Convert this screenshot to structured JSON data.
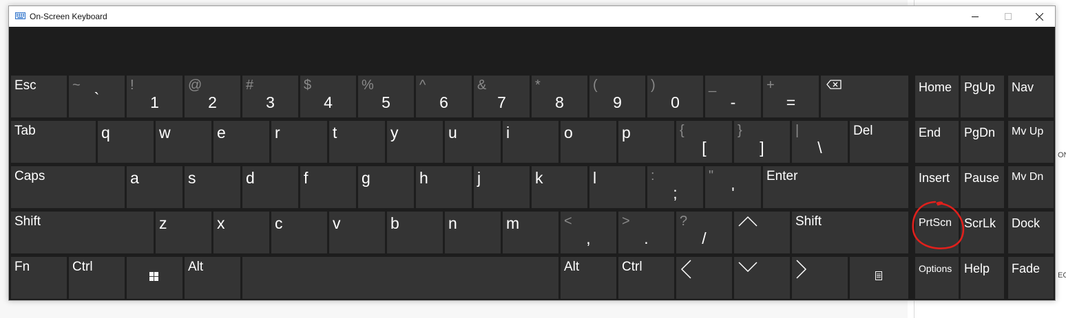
{
  "window": {
    "title": "On-Screen Keyboard"
  },
  "background": {
    "partial_text_1": "ON",
    "partial_text_2": "EC"
  },
  "keys": {
    "esc": "Esc",
    "tilde_top": "~",
    "tilde_bot": "`",
    "k1_top": "!",
    "k1_bot": "1",
    "k2_top": "@",
    "k2_bot": "2",
    "k3_top": "#",
    "k3_bot": "3",
    "k4_top": "$",
    "k4_bot": "4",
    "k5_top": "%",
    "k5_bot": "5",
    "k6_top": "^",
    "k6_bot": "6",
    "k7_top": "&",
    "k7_bot": "7",
    "k8_top": "*",
    "k8_bot": "8",
    "k9_top": "(",
    "k9_bot": "9",
    "k0_top": ")",
    "k0_bot": "0",
    "minus_top": "_",
    "minus_bot": "-",
    "equal_top": "+",
    "equal_bot": "=",
    "home": "Home",
    "pgup": "PgUp",
    "nav": "Nav",
    "tab": "Tab",
    "q": "q",
    "w": "w",
    "e": "e",
    "r": "r",
    "t": "t",
    "y": "y",
    "u": "u",
    "i": "i",
    "o": "o",
    "p": "p",
    "lbracket_top": "{",
    "lbracket_bot": "[",
    "rbracket_top": "}",
    "rbracket_bot": "]",
    "backslash_top": "|",
    "backslash_bot": "\\",
    "del": "Del",
    "end": "End",
    "pgdn": "PgDn",
    "mvup": "Mv Up",
    "caps": "Caps",
    "a": "a",
    "s": "s",
    "d": "d",
    "f": "f",
    "g": "g",
    "h": "h",
    "j": "j",
    "k": "k",
    "l": "l",
    "semicolon_top": ":",
    "semicolon_bot": ";",
    "quote_top": "\"",
    "quote_bot": "'",
    "enter": "Enter",
    "insert": "Insert",
    "pause": "Pause",
    "mvdn": "Mv Dn",
    "shift": "Shift",
    "z": "z",
    "x": "x",
    "c": "c",
    "v": "v",
    "b": "b",
    "n": "n",
    "m": "m",
    "comma_top": "<",
    "comma_bot": ",",
    "period_top": ">",
    "period_bot": ".",
    "slash_top": "?",
    "slash_bot": "/",
    "prtscn": "PrtScn",
    "scrlk": "ScrLk",
    "dock": "Dock",
    "fn": "Fn",
    "ctrl": "Ctrl",
    "alt": "Alt",
    "options": "Options",
    "help": "Help",
    "fade": "Fade"
  },
  "annotation": {
    "color": "#e0201c",
    "target": "PrtScn"
  }
}
